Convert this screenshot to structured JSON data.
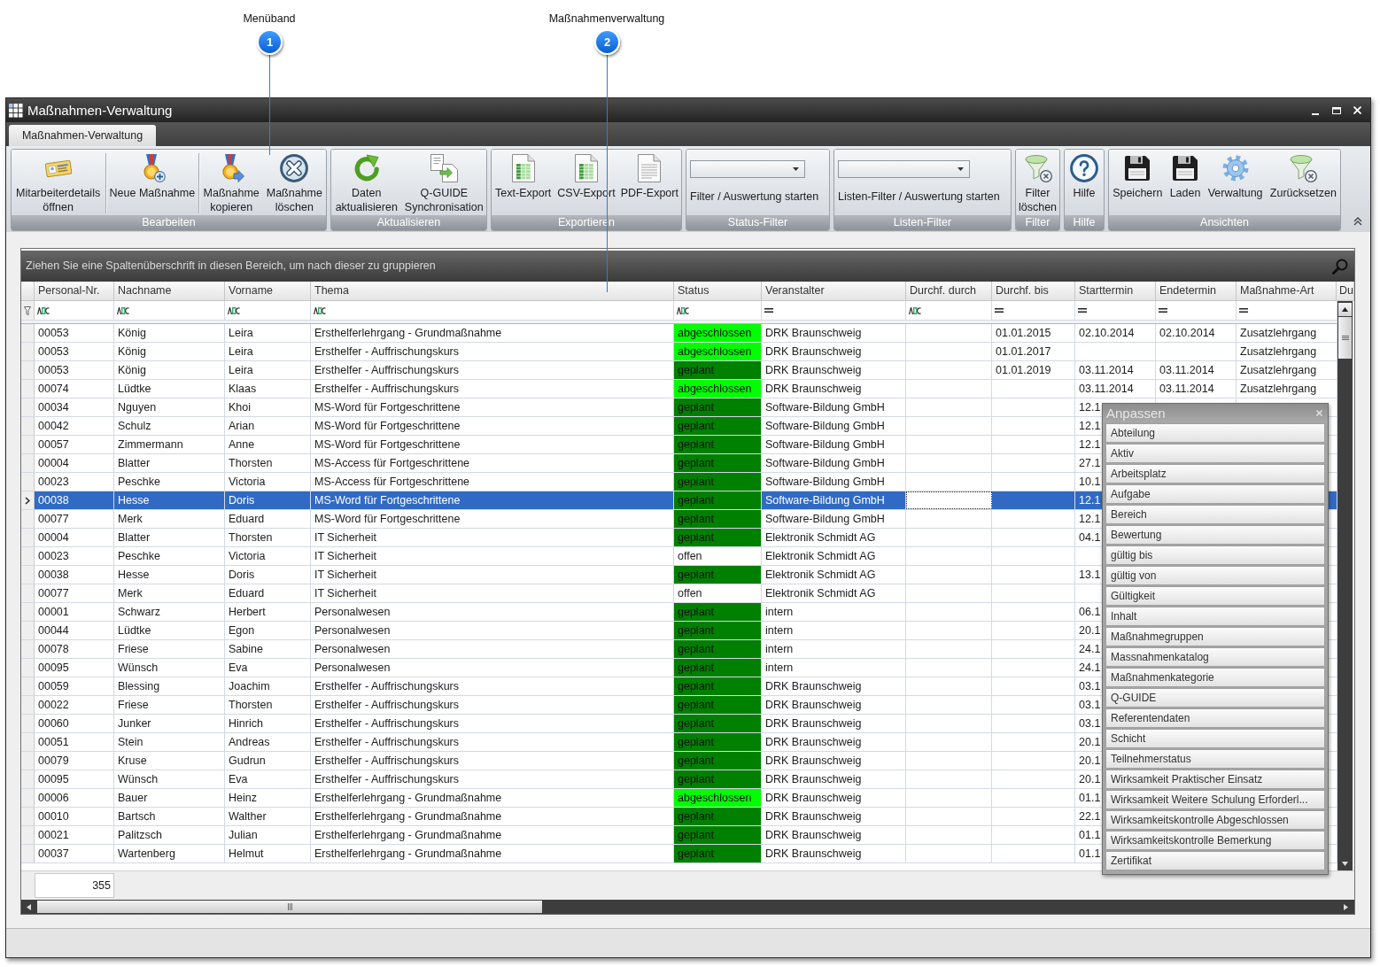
{
  "callouts": [
    {
      "number": "1",
      "label": "Menüband"
    },
    {
      "number": "2",
      "label": "Maßnahmenverwaltung"
    }
  ],
  "window": {
    "title": "Maßnahmen-Verwaltung"
  },
  "tabs": [
    {
      "label": "Maßnahmen-Verwaltung",
      "selected": true
    }
  ],
  "ribbon": {
    "groups": [
      {
        "label": "Bearbeiten",
        "items": [
          {
            "kind": "button",
            "label": "Mitarbeiterdetails öffnen"
          },
          {
            "kind": "separator"
          },
          {
            "kind": "button",
            "label": "Neue Maßnahme"
          },
          {
            "kind": "separator"
          },
          {
            "kind": "button",
            "label": "Maßnahme kopieren"
          },
          {
            "kind": "button",
            "label": "Maßnahme löschen"
          }
        ]
      },
      {
        "label": "Aktualisieren",
        "items": [
          {
            "kind": "button",
            "label": "Daten aktualisieren"
          },
          {
            "kind": "button",
            "label": "Q-GUIDE Synchronisation"
          }
        ]
      },
      {
        "label": "Exportieren",
        "items": [
          {
            "kind": "button",
            "label": "Text-Export"
          },
          {
            "kind": "button",
            "label": "CSV-Export"
          },
          {
            "kind": "button",
            "label": "PDF-Export"
          }
        ]
      },
      {
        "label": "Status-Filter",
        "items": [
          {
            "kind": "dropdown"
          },
          {
            "kind": "text_button",
            "label": "Filter / Auswertung starten"
          }
        ]
      },
      {
        "label": "Listen-Filter",
        "items": [
          {
            "kind": "dropdown"
          },
          {
            "kind": "text_button",
            "label": "Listen-Filter / Auswertung starten"
          }
        ]
      },
      {
        "label": "Filter",
        "items": [
          {
            "kind": "button",
            "label": "Filter löschen"
          }
        ]
      },
      {
        "label": "Hilfe",
        "items": [
          {
            "kind": "button",
            "label": "Hilfe"
          }
        ]
      },
      {
        "label": "Ansichten",
        "items": [
          {
            "kind": "button",
            "label": "Speichern"
          },
          {
            "kind": "button",
            "label": "Laden"
          },
          {
            "kind": "button",
            "label": "Verwaltung"
          },
          {
            "kind": "button",
            "label": "Zurücksetzen"
          }
        ]
      }
    ]
  },
  "grid": {
    "group_hint": "Ziehen Sie eine Spaltenüberschrift in diesen Bereich, um nach dieser zu gruppieren",
    "columns": [
      {
        "label": "Personal-Nr.",
        "kind": "text"
      },
      {
        "label": "Nachname",
        "kind": "text"
      },
      {
        "label": "Vorname",
        "kind": "text"
      },
      {
        "label": "Thema",
        "kind": "text"
      },
      {
        "label": "Status",
        "kind": "text"
      },
      {
        "label": "Veranstalter",
        "kind": "equals"
      },
      {
        "label": "Durchf. durch",
        "kind": "text"
      },
      {
        "label": "Durchf. bis",
        "kind": "equals"
      },
      {
        "label": "Starttermin",
        "kind": "equals"
      },
      {
        "label": "Endetermin",
        "kind": "equals"
      },
      {
        "label": "Maßnahme-Art",
        "kind": "equals"
      },
      {
        "label": "Du"
      }
    ],
    "rows": [
      {
        "personal_nr": "00053",
        "nachname": "König",
        "vorname": "Leira",
        "thema": "Ersthelferlehrgang - Grundmaßnahme",
        "status": "abgeschlossen",
        "color": "#00ff00",
        "veranstalter": "DRK Braunschweig",
        "durchf_bis": "01.01.2015",
        "starttermin": "02.10.2014",
        "endetermin": "02.10.2014",
        "massnahme_art": "Zusatzlehrgang",
        "selected": false
      },
      {
        "personal_nr": "00053",
        "nachname": "König",
        "vorname": "Leira",
        "thema": "Ersthelfer - Auffrischungskurs",
        "status": "abgeschlossen",
        "color": "#00ff00",
        "veranstalter": "DRK Braunschweig",
        "durchf_bis": "01.01.2017",
        "massnahme_art": "Zusatzlehrgang",
        "selected": false
      },
      {
        "personal_nr": "00053",
        "nachname": "König",
        "vorname": "Leira",
        "thema": "Ersthelfer - Auffrischungskurs",
        "status": "geplant",
        "color": "#008000",
        "veranstalter": "DRK Braunschweig",
        "durchf_bis": "01.01.2019",
        "starttermin": "03.11.2014",
        "endetermin": "03.11.2014",
        "massnahme_art": "Zusatzlehrgang",
        "selected": false
      },
      {
        "personal_nr": "00074",
        "nachname": "Lüdtke",
        "vorname": "Klaas",
        "thema": "Ersthelfer - Auffrischungskurs",
        "status": "abgeschlossen",
        "color": "#00ff00",
        "veranstalter": "DRK Braunschweig",
        "starttermin": "03.11.2014",
        "endetermin": "03.11.2014",
        "massnahme_art": "Zusatzlehrgang",
        "selected": false
      },
      {
        "personal_nr": "00034",
        "nachname": "Nguyen",
        "vorname": "Khoi",
        "thema": "MS-Word für Fortgeschrittene",
        "status": "geplant",
        "color": "#008000",
        "veranstalter": "Software-Bildung GmbH",
        "starttermin": "12.1",
        "selected": false
      },
      {
        "personal_nr": "00042",
        "nachname": "Schulz",
        "vorname": "Arian",
        "thema": "MS-Word für Fortgeschrittene",
        "status": "geplant",
        "color": "#008000",
        "veranstalter": "Software-Bildung GmbH",
        "starttermin": "12.1",
        "selected": false
      },
      {
        "personal_nr": "00057",
        "nachname": "Zimmermann",
        "vorname": "Anne",
        "thema": "MS-Word für Fortgeschrittene",
        "status": "geplant",
        "color": "#008000",
        "veranstalter": "Software-Bildung GmbH",
        "starttermin": "12.1",
        "selected": false
      },
      {
        "personal_nr": "00004",
        "nachname": "Blatter",
        "vorname": "Thorsten",
        "thema": "MS-Access für Fortgeschrittene",
        "status": "geplant",
        "color": "#008000",
        "veranstalter": "Software-Bildung GmbH",
        "starttermin": "27.1",
        "selected": false
      },
      {
        "personal_nr": "00023",
        "nachname": "Peschke",
        "vorname": "Victoria",
        "thema": "MS-Access für Fortgeschrittene",
        "status": "geplant",
        "color": "#008000",
        "veranstalter": "Software-Bildung GmbH",
        "starttermin": "10.1",
        "selected": false
      },
      {
        "personal_nr": "00038",
        "nachname": "Hesse",
        "vorname": "Doris",
        "thema": "MS-Word für Fortgeschrittene",
        "status": "geplant",
        "color": "#008000",
        "veranstalter": "Software-Bildung GmbH",
        "starttermin": "12.1",
        "selected": true
      },
      {
        "personal_nr": "00077",
        "nachname": "Merk",
        "vorname": "Eduard",
        "thema": "MS-Word für Fortgeschrittene",
        "status": "geplant",
        "color": "#008000",
        "veranstalter": "Software-Bildung GmbH",
        "starttermin": "12.1",
        "selected": false
      },
      {
        "personal_nr": "00004",
        "nachname": "Blatter",
        "vorname": "Thorsten",
        "thema": "IT Sicherheit",
        "status": "geplant",
        "color": "#008000",
        "veranstalter": "Elektronik Schmidt AG",
        "starttermin": "04.1",
        "selected": false
      },
      {
        "personal_nr": "00023",
        "nachname": "Peschke",
        "vorname": "Victoria",
        "thema": "IT Sicherheit",
        "status": "offen",
        "veranstalter": "Elektronik Schmidt AG",
        "selected": false
      },
      {
        "personal_nr": "00038",
        "nachname": "Hesse",
        "vorname": "Doris",
        "thema": "IT Sicherheit",
        "status": "geplant",
        "color": "#008000",
        "veranstalter": "Elektronik Schmidt AG",
        "starttermin": "13.1",
        "selected": false
      },
      {
        "personal_nr": "00077",
        "nachname": "Merk",
        "vorname": "Eduard",
        "thema": "IT Sicherheit",
        "status": "offen",
        "veranstalter": "Elektronik Schmidt AG",
        "selected": false
      },
      {
        "personal_nr": "00001",
        "nachname": "Schwarz",
        "vorname": "Herbert",
        "thema": "Personalwesen",
        "status": "geplant",
        "color": "#008000",
        "veranstalter": "intern",
        "starttermin": "06.1",
        "selected": false
      },
      {
        "personal_nr": "00044",
        "nachname": "Lüdtke",
        "vorname": "Egon",
        "thema": "Personalwesen",
        "status": "geplant",
        "color": "#008000",
        "veranstalter": "intern",
        "starttermin": "20.1",
        "selected": false
      },
      {
        "personal_nr": "00078",
        "nachname": "Friese",
        "vorname": "Sabine",
        "thema": "Personalwesen",
        "status": "geplant",
        "color": "#008000",
        "veranstalter": "intern",
        "starttermin": "24.1",
        "selected": false
      },
      {
        "personal_nr": "00095",
        "nachname": "Wünsch",
        "vorname": "Eva",
        "thema": "Personalwesen",
        "status": "geplant",
        "color": "#008000",
        "veranstalter": "intern",
        "starttermin": "24.1",
        "selected": false
      },
      {
        "personal_nr": "00059",
        "nachname": "Blessing",
        "vorname": "Joachim",
        "thema": "Ersthelfer - Auffrischungskurs",
        "status": "geplant",
        "color": "#008000",
        "veranstalter": "DRK Braunschweig",
        "starttermin": "03.1",
        "selected": false
      },
      {
        "personal_nr": "00022",
        "nachname": "Friese",
        "vorname": "Thorsten",
        "thema": "Ersthelfer - Auffrischungskurs",
        "status": "geplant",
        "color": "#008000",
        "veranstalter": "DRK Braunschweig",
        "starttermin": "03.1",
        "selected": false
      },
      {
        "personal_nr": "00060",
        "nachname": "Junker",
        "vorname": "Hinrich",
        "thema": "Ersthelfer - Auffrischungskurs",
        "status": "geplant",
        "color": "#008000",
        "veranstalter": "DRK Braunschweig",
        "starttermin": "03.1",
        "selected": false
      },
      {
        "personal_nr": "00051",
        "nachname": "Stein",
        "vorname": "Andreas",
        "thema": "Ersthelfer - Auffrischungskurs",
        "status": "geplant",
        "color": "#008000",
        "veranstalter": "DRK Braunschweig",
        "starttermin": "20.1",
        "selected": false
      },
      {
        "personal_nr": "00079",
        "nachname": "Kruse",
        "vorname": "Gudrun",
        "thema": "Ersthelfer - Auffrischungskurs",
        "status": "geplant",
        "color": "#008000",
        "veranstalter": "DRK Braunschweig",
        "starttermin": "20.1",
        "selected": false
      },
      {
        "personal_nr": "00095",
        "nachname": "Wünsch",
        "vorname": "Eva",
        "thema": "Ersthelfer - Auffrischungskurs",
        "status": "geplant",
        "color": "#008000",
        "veranstalter": "DRK Braunschweig",
        "starttermin": "20.1",
        "selected": false
      },
      {
        "personal_nr": "00006",
        "nachname": "Bauer",
        "vorname": "Heinz",
        "thema": "Ersthelferlehrgang - Grundmaßnahme",
        "status": "abgeschlossen",
        "color": "#00ff00",
        "veranstalter": "DRK Braunschweig",
        "starttermin": "01.1",
        "selected": false
      },
      {
        "personal_nr": "00010",
        "nachname": "Bartsch",
        "vorname": "Walther",
        "thema": "Ersthelferlehrgang - Grundmaßnahme",
        "status": "geplant",
        "color": "#008000",
        "veranstalter": "DRK Braunschweig",
        "starttermin": "22.1",
        "selected": false
      },
      {
        "personal_nr": "00021",
        "nachname": "Palitzsch",
        "vorname": "Julian",
        "thema": "Ersthelferlehrgang - Grundmaßnahme",
        "status": "geplant",
        "color": "#008000",
        "veranstalter": "DRK Braunschweig",
        "starttermin": "01.1",
        "selected": false
      },
      {
        "personal_nr": "00037",
        "nachname": "Wartenberg",
        "vorname": "Helmut",
        "thema": "Ersthelferlehrgang - Grundmaßnahme",
        "status": "geplant",
        "color": "#008000",
        "veranstalter": "DRK Braunschweig",
        "starttermin": "01.1",
        "selected": false
      }
    ],
    "row_count": "355"
  },
  "customize_panel": {
    "title": "Anpassen",
    "items": [
      "Abteilung",
      "Aktiv",
      "Arbeitsplatz",
      "Aufgabe",
      "Bereich",
      "Bewertung",
      "gültig bis",
      "gültig von",
      "Gültigkeit",
      "Inhalt",
      "Maßnahmegruppen",
      "Massnahmenkatalog",
      "Maßnahmenkategorie",
      "Q-GUIDE",
      "Referentendaten",
      "Schicht",
      "Teilnehmerstatus",
      "Wirksamkeit Praktischer Einsatz",
      "Wirksamkeit Weitere Schulung Erforderl...",
      "Wirksamkeitskontrolle Abgeschlossen",
      "Wirksamkeitskontrolle Bemerkung",
      "Zertifikat"
    ]
  }
}
